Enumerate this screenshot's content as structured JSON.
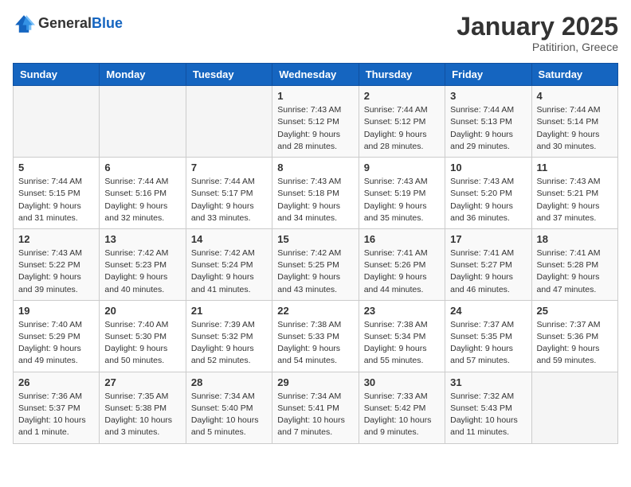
{
  "logo": {
    "general": "General",
    "blue": "Blue"
  },
  "header": {
    "title": "January 2025",
    "subtitle": "Patitirion, Greece"
  },
  "weekdays": [
    "Sunday",
    "Monday",
    "Tuesday",
    "Wednesday",
    "Thursday",
    "Friday",
    "Saturday"
  ],
  "weeks": [
    [
      {
        "day": "",
        "content": ""
      },
      {
        "day": "",
        "content": ""
      },
      {
        "day": "",
        "content": ""
      },
      {
        "day": "1",
        "content": "Sunrise: 7:43 AM\nSunset: 5:12 PM\nDaylight: 9 hours and 28 minutes."
      },
      {
        "day": "2",
        "content": "Sunrise: 7:44 AM\nSunset: 5:12 PM\nDaylight: 9 hours and 28 minutes."
      },
      {
        "day": "3",
        "content": "Sunrise: 7:44 AM\nSunset: 5:13 PM\nDaylight: 9 hours and 29 minutes."
      },
      {
        "day": "4",
        "content": "Sunrise: 7:44 AM\nSunset: 5:14 PM\nDaylight: 9 hours and 30 minutes."
      }
    ],
    [
      {
        "day": "5",
        "content": "Sunrise: 7:44 AM\nSunset: 5:15 PM\nDaylight: 9 hours and 31 minutes."
      },
      {
        "day": "6",
        "content": "Sunrise: 7:44 AM\nSunset: 5:16 PM\nDaylight: 9 hours and 32 minutes."
      },
      {
        "day": "7",
        "content": "Sunrise: 7:44 AM\nSunset: 5:17 PM\nDaylight: 9 hours and 33 minutes."
      },
      {
        "day": "8",
        "content": "Sunrise: 7:43 AM\nSunset: 5:18 PM\nDaylight: 9 hours and 34 minutes."
      },
      {
        "day": "9",
        "content": "Sunrise: 7:43 AM\nSunset: 5:19 PM\nDaylight: 9 hours and 35 minutes."
      },
      {
        "day": "10",
        "content": "Sunrise: 7:43 AM\nSunset: 5:20 PM\nDaylight: 9 hours and 36 minutes."
      },
      {
        "day": "11",
        "content": "Sunrise: 7:43 AM\nSunset: 5:21 PM\nDaylight: 9 hours and 37 minutes."
      }
    ],
    [
      {
        "day": "12",
        "content": "Sunrise: 7:43 AM\nSunset: 5:22 PM\nDaylight: 9 hours and 39 minutes."
      },
      {
        "day": "13",
        "content": "Sunrise: 7:42 AM\nSunset: 5:23 PM\nDaylight: 9 hours and 40 minutes."
      },
      {
        "day": "14",
        "content": "Sunrise: 7:42 AM\nSunset: 5:24 PM\nDaylight: 9 hours and 41 minutes."
      },
      {
        "day": "15",
        "content": "Sunrise: 7:42 AM\nSunset: 5:25 PM\nDaylight: 9 hours and 43 minutes."
      },
      {
        "day": "16",
        "content": "Sunrise: 7:41 AM\nSunset: 5:26 PM\nDaylight: 9 hours and 44 minutes."
      },
      {
        "day": "17",
        "content": "Sunrise: 7:41 AM\nSunset: 5:27 PM\nDaylight: 9 hours and 46 minutes."
      },
      {
        "day": "18",
        "content": "Sunrise: 7:41 AM\nSunset: 5:28 PM\nDaylight: 9 hours and 47 minutes."
      }
    ],
    [
      {
        "day": "19",
        "content": "Sunrise: 7:40 AM\nSunset: 5:29 PM\nDaylight: 9 hours and 49 minutes."
      },
      {
        "day": "20",
        "content": "Sunrise: 7:40 AM\nSunset: 5:30 PM\nDaylight: 9 hours and 50 minutes."
      },
      {
        "day": "21",
        "content": "Sunrise: 7:39 AM\nSunset: 5:32 PM\nDaylight: 9 hours and 52 minutes."
      },
      {
        "day": "22",
        "content": "Sunrise: 7:38 AM\nSunset: 5:33 PM\nDaylight: 9 hours and 54 minutes."
      },
      {
        "day": "23",
        "content": "Sunrise: 7:38 AM\nSunset: 5:34 PM\nDaylight: 9 hours and 55 minutes."
      },
      {
        "day": "24",
        "content": "Sunrise: 7:37 AM\nSunset: 5:35 PM\nDaylight: 9 hours and 57 minutes."
      },
      {
        "day": "25",
        "content": "Sunrise: 7:37 AM\nSunset: 5:36 PM\nDaylight: 9 hours and 59 minutes."
      }
    ],
    [
      {
        "day": "26",
        "content": "Sunrise: 7:36 AM\nSunset: 5:37 PM\nDaylight: 10 hours and 1 minute."
      },
      {
        "day": "27",
        "content": "Sunrise: 7:35 AM\nSunset: 5:38 PM\nDaylight: 10 hours and 3 minutes."
      },
      {
        "day": "28",
        "content": "Sunrise: 7:34 AM\nSunset: 5:40 PM\nDaylight: 10 hours and 5 minutes."
      },
      {
        "day": "29",
        "content": "Sunrise: 7:34 AM\nSunset: 5:41 PM\nDaylight: 10 hours and 7 minutes."
      },
      {
        "day": "30",
        "content": "Sunrise: 7:33 AM\nSunset: 5:42 PM\nDaylight: 10 hours and 9 minutes."
      },
      {
        "day": "31",
        "content": "Sunrise: 7:32 AM\nSunset: 5:43 PM\nDaylight: 10 hours and 11 minutes."
      },
      {
        "day": "",
        "content": ""
      }
    ]
  ]
}
